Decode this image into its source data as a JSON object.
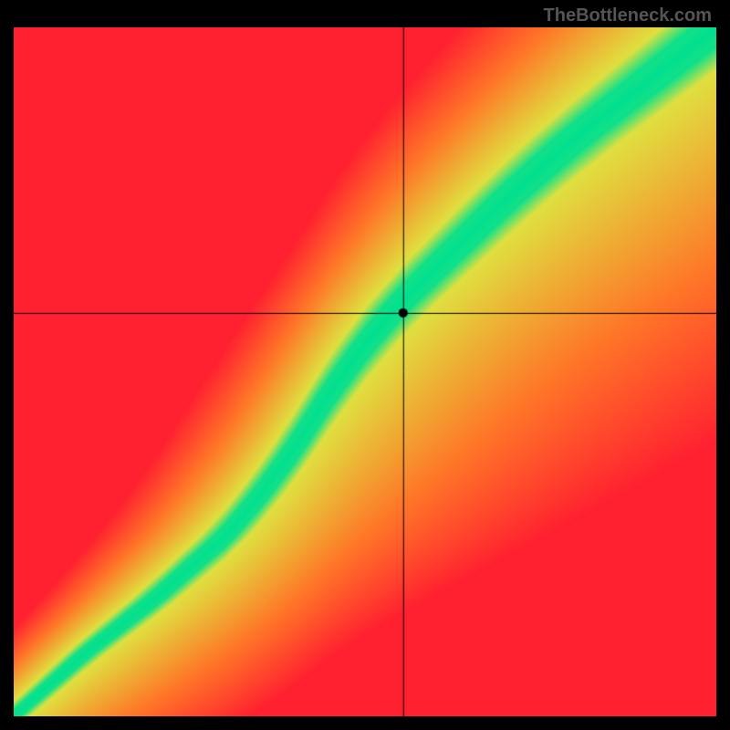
{
  "watermark": "TheBottleneck.com",
  "chart_data": {
    "type": "heatmap",
    "title": "",
    "xlabel": "",
    "ylabel": "",
    "xlim": [
      0,
      100
    ],
    "ylim": [
      0,
      100
    ],
    "crosshair": {
      "x": 55.5,
      "y": 58.5
    },
    "marker": {
      "x": 55.5,
      "y": 58.5
    },
    "optimal_curve": {
      "description": "Green ridge path from bottom-left to top-right with S-curve shape",
      "points": [
        {
          "x": 0,
          "y": 0
        },
        {
          "x": 10,
          "y": 9
        },
        {
          "x": 20,
          "y": 17
        },
        {
          "x": 30,
          "y": 26
        },
        {
          "x": 35,
          "y": 32
        },
        {
          "x": 40,
          "y": 39
        },
        {
          "x": 45,
          "y": 47
        },
        {
          "x": 50,
          "y": 54
        },
        {
          "x": 55,
          "y": 60
        },
        {
          "x": 60,
          "y": 65
        },
        {
          "x": 70,
          "y": 75
        },
        {
          "x": 80,
          "y": 84
        },
        {
          "x": 90,
          "y": 92
        },
        {
          "x": 100,
          "y": 100
        }
      ],
      "ridge_width_estimate": 6
    },
    "color_gradient": {
      "optimal": "#00E090",
      "near": "#E0E040",
      "far_upper_left": "#FF2030",
      "far_lower_right": "#FF3030",
      "corner_top_right": "#FFE040",
      "corner_bottom_left": "#FF2020"
    }
  }
}
